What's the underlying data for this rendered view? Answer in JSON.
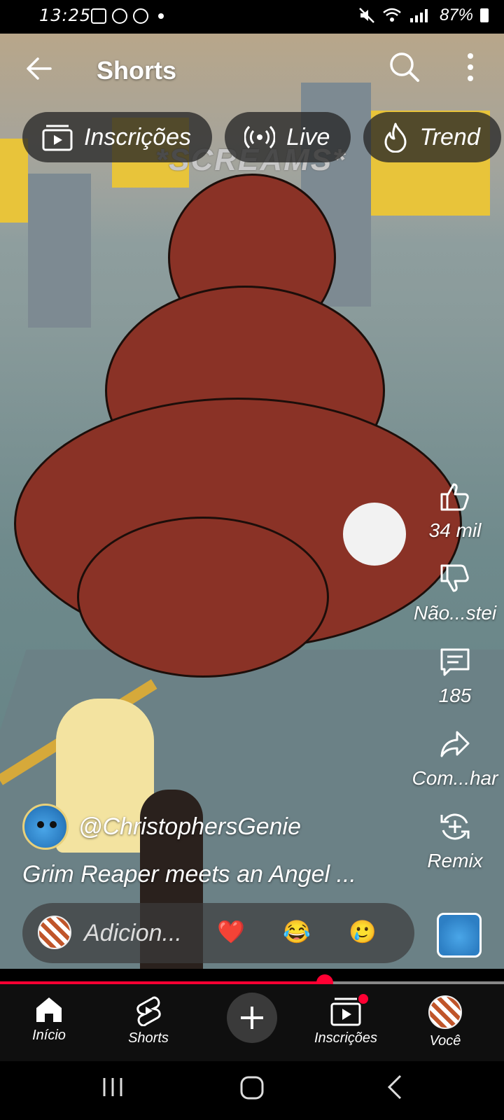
{
  "status_bar": {
    "time": "13:25",
    "battery": "87%"
  },
  "header": {
    "title": "Shorts"
  },
  "chips": [
    {
      "label": "Inscrições",
      "icon": "subscriptions-icon"
    },
    {
      "label": "Live",
      "icon": "live-icon"
    },
    {
      "label": "Trend",
      "icon": "trending-icon"
    }
  ],
  "video": {
    "overlay_text": "*SCREAMS*",
    "channel": "@ChristophersGenie",
    "title": "Grim Reaper meets an Angel  ..."
  },
  "actions": {
    "like_count": "34 mil",
    "dislike_label": "Não...stei",
    "comment_count": "185",
    "share_label": "Com...har",
    "remix_label": "Remix"
  },
  "comment_bar": {
    "placeholder": "Adicion...",
    "emojis": [
      "❤️",
      "😂",
      "🥲"
    ]
  },
  "progress": {
    "played_fraction": 0.645
  },
  "bottom_nav": [
    {
      "label": "Início",
      "icon": "home-icon"
    },
    {
      "label": "Shorts",
      "icon": "shorts-icon"
    },
    {
      "label": "",
      "icon": "create-icon"
    },
    {
      "label": "Inscrições",
      "icon": "subscriptions-icon"
    },
    {
      "label": "Você",
      "icon": "avatar"
    }
  ],
  "colors": {
    "accent": "#ff0033",
    "chip_bg": "#282828",
    "nav_bg": "#0f0f0f"
  }
}
